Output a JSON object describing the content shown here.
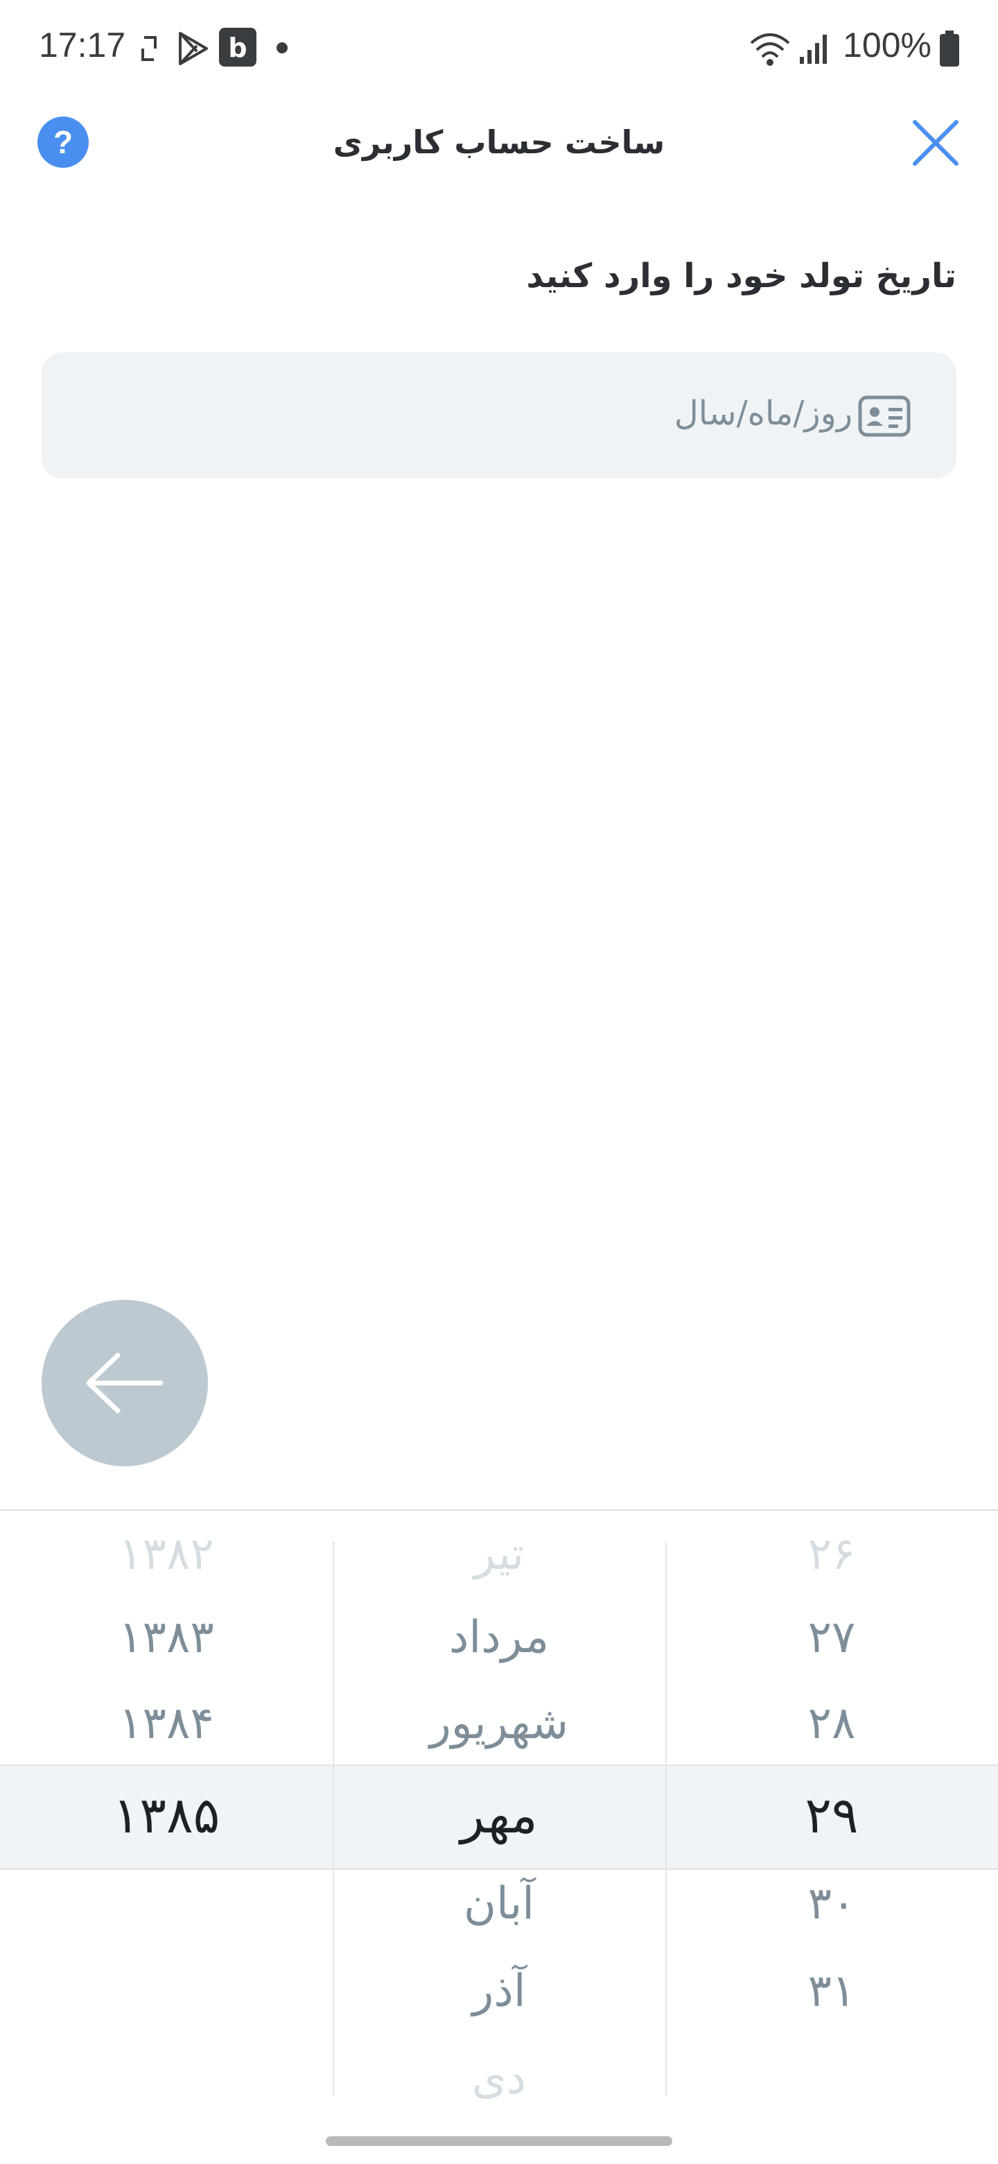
{
  "status_bar": {
    "time": "17:17",
    "battery": "100%",
    "icons": [
      "screen-rotate-icon",
      "play-store-icon",
      "app-b-icon",
      "dot-icon",
      "wifi-icon",
      "signal-icon",
      "battery-icon"
    ]
  },
  "header": {
    "title": "ساخت حساب کاربری",
    "help_label": "?",
    "close_icon": "close-icon",
    "accent_color": "#4a8ff0"
  },
  "form": {
    "question": "تاریخ تولد خود را وارد کنید",
    "date_placeholder": "روز/ماه/سال",
    "input_icon": "id-card-icon"
  },
  "next_button": {
    "icon": "arrow-left-icon"
  },
  "picker": {
    "year": {
      "items": [
        "۱۳۸۲",
        "۱۳۸۳",
        "۱۳۸۴",
        "۱۳۸۵"
      ],
      "selected": "۱۳۸۵"
    },
    "month": {
      "items": [
        "تیر",
        "مرداد",
        "شهریور",
        "مهر",
        "آبان",
        "آذر",
        "دی"
      ],
      "selected": "مهر"
    },
    "day": {
      "items": [
        "۲۶",
        "۲۷",
        "۲۸",
        "۲۹",
        "۳۰",
        "۳۱"
      ],
      "selected": "۲۹"
    }
  }
}
